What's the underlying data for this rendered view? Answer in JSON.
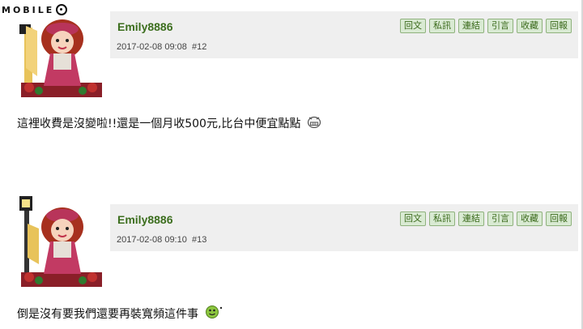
{
  "site": {
    "logo_text": "MOBILE"
  },
  "post_actions": [
    "回文",
    "私訊",
    "連結",
    "引言",
    "收藏",
    "回報"
  ],
  "posts": [
    {
      "username": "Emily8886",
      "datetime": "2017-02-08 09:08",
      "floor": "#12",
      "content": "這裡收費是沒變啦!!還是一個月收500元,比台中便宜點點",
      "smiley": "grin-smiley-icon"
    },
    {
      "username": "Emily8886",
      "datetime": "2017-02-08 09:10",
      "floor": "#13",
      "content": "倒是沒有要我們還要再裝寬頻這件事",
      "smiley": "green-smiley-icon"
    }
  ]
}
